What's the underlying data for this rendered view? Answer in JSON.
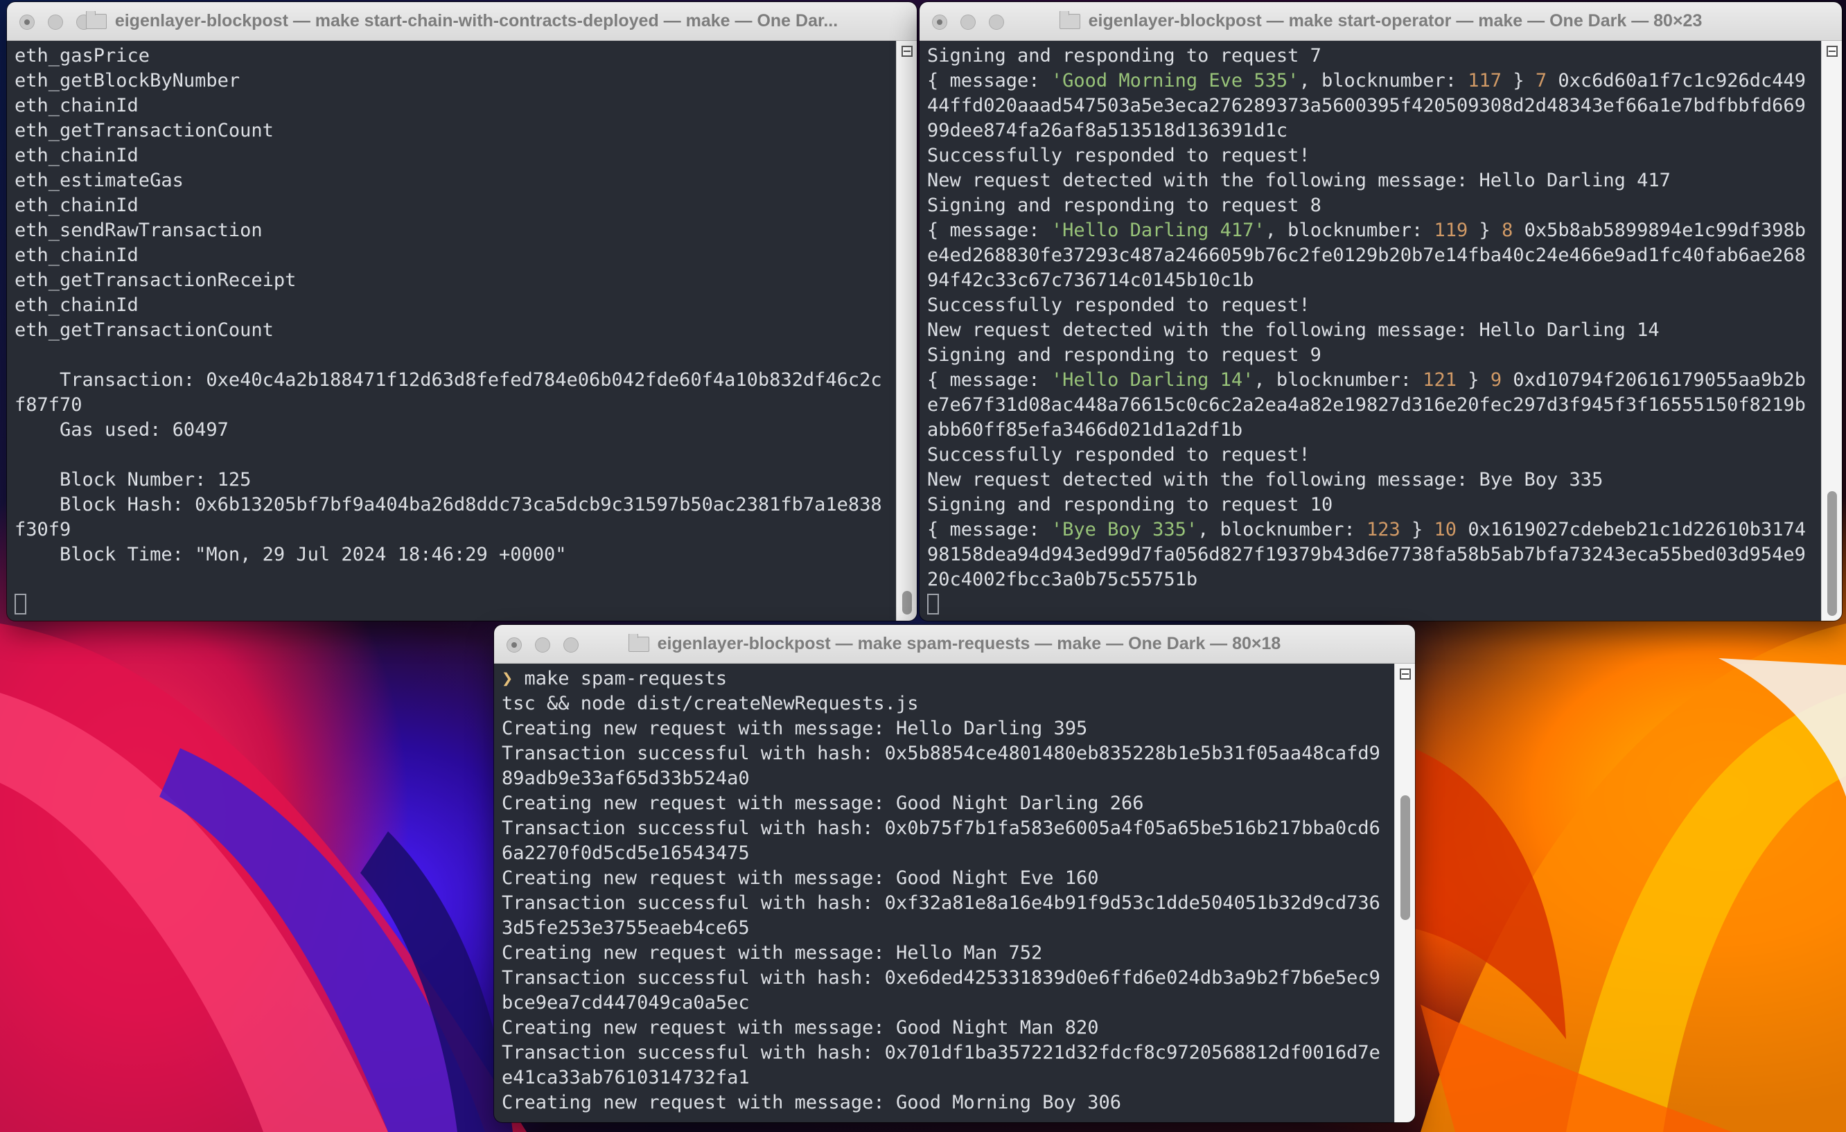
{
  "window_left": {
    "title": "eigenlayer-blockpost — make start-chain-with-contracts-deployed — make — One Dar...",
    "lines": [
      [
        {
          "t": "eth_gasPrice"
        }
      ],
      [
        {
          "t": "eth_getBlockByNumber"
        }
      ],
      [
        {
          "t": "eth_chainId"
        }
      ],
      [
        {
          "t": "eth_getTransactionCount"
        }
      ],
      [
        {
          "t": "eth_chainId"
        }
      ],
      [
        {
          "t": "eth_estimateGas"
        }
      ],
      [
        {
          "t": "eth_chainId"
        }
      ],
      [
        {
          "t": "eth_sendRawTransaction"
        }
      ],
      [
        {
          "t": "eth_chainId"
        }
      ],
      [
        {
          "t": "eth_getTransactionReceipt"
        }
      ],
      [
        {
          "t": "eth_chainId"
        }
      ],
      [
        {
          "t": "eth_getTransactionCount"
        }
      ],
      [
        {
          "t": ""
        }
      ],
      [
        {
          "t": "    Transaction: 0xe40c4a2b188471f12d63d8fefed784e06b042fde60f4a10b832df46c2cf87f70"
        }
      ],
      [
        {
          "t": "    Gas used: 60497"
        }
      ],
      [
        {
          "t": ""
        }
      ],
      [
        {
          "t": "    Block Number: 125"
        }
      ],
      [
        {
          "t": "    Block Hash: 0x6b13205bf7bf9a404ba26d8ddc73ca5dcb9c31597b50ac2381fb7a1e838f30f9"
        }
      ],
      [
        {
          "t": "    Block Time: \"Mon, 29 Jul 2024 18:46:29 +0000\""
        }
      ],
      [
        {
          "t": ""
        }
      ],
      [
        {
          "t": "",
          "cursor": true
        }
      ]
    ]
  },
  "window_right": {
    "title": "eigenlayer-blockpost — make start-operator — make — One Dark — 80×23",
    "lines": [
      [
        {
          "t": "Signing and responding to request 7"
        }
      ],
      [
        {
          "t": "{ message: "
        },
        {
          "t": "'Good Morning Eve 535'",
          "c": "g"
        },
        {
          "t": ", blocknumber: "
        },
        {
          "t": "117",
          "c": "o"
        },
        {
          "t": " } "
        },
        {
          "t": "7",
          "c": "o"
        },
        {
          "t": " 0xc6d60a1f7c1c926dc44944ffd020aaad547503a5e3eca276289373a5600395f420509308d2d48343ef66a1e7bdfbbfd66999dee874fa26af8a513518d136391d1c"
        }
      ],
      [
        {
          "t": "Successfully responded to request!"
        }
      ],
      [
        {
          "t": "New request detected with the following message: Hello Darling 417"
        }
      ],
      [
        {
          "t": "Signing and responding to request 8"
        }
      ],
      [
        {
          "t": "{ message: "
        },
        {
          "t": "'Hello Darling 417'",
          "c": "g"
        },
        {
          "t": ", blocknumber: "
        },
        {
          "t": "119",
          "c": "o"
        },
        {
          "t": " } "
        },
        {
          "t": "8",
          "c": "o"
        },
        {
          "t": " 0x5b8ab5899894e1c99df398be4ed268830fe37293c487a2466059b76c2fe0129b20b7e14fba40c24e466e9ad1fc40fab6ae26894f42c33c67c736714c0145b10c1b"
        }
      ],
      [
        {
          "t": "Successfully responded to request!"
        }
      ],
      [
        {
          "t": "New request detected with the following message: Hello Darling 14"
        }
      ],
      [
        {
          "t": "Signing and responding to request 9"
        }
      ],
      [
        {
          "t": "{ message: "
        },
        {
          "t": "'Hello Darling 14'",
          "c": "g"
        },
        {
          "t": ", blocknumber: "
        },
        {
          "t": "121",
          "c": "o"
        },
        {
          "t": " } "
        },
        {
          "t": "9",
          "c": "o"
        },
        {
          "t": " 0xd10794f20616179055aa9b2be7e67f31d08ac448a76615c0c6c2a2ea4a82e19827d316e20fec297d3f945f3f16555150f8219babb60ff85efa3466d021d1a2df1b"
        }
      ],
      [
        {
          "t": "Successfully responded to request!"
        }
      ],
      [
        {
          "t": "New request detected with the following message: Bye Boy 335"
        }
      ],
      [
        {
          "t": "Signing and responding to request 10"
        }
      ],
      [
        {
          "t": "{ message: "
        },
        {
          "t": "'Bye Boy 335'",
          "c": "g"
        },
        {
          "t": ", blocknumber: "
        },
        {
          "t": "123",
          "c": "o"
        },
        {
          "t": " } "
        },
        {
          "t": "10",
          "c": "o"
        },
        {
          "t": " 0x1619027cdebeb21c1d22610b317498158dea94d943ed99d7fa056d827f19379b43d6e7738fa58b5ab7bfa73243eca55bed03d954e920c4002fbcc3a0b75c55751b"
        }
      ],
      [
        {
          "t": "",
          "cursor": true
        }
      ]
    ]
  },
  "window_bottom": {
    "title": "eigenlayer-blockpost — make spam-requests — make — One Dark — 80×18",
    "lines": [
      [
        {
          "t": "❯",
          "c": "y"
        },
        {
          "t": " make spam-requests"
        }
      ],
      [
        {
          "t": "tsc && node dist/createNewRequests.js"
        }
      ],
      [
        {
          "t": "Creating new request with message: Hello Darling 395"
        }
      ],
      [
        {
          "t": "Transaction successful with hash: 0x5b8854ce4801480eb835228b1e5b31f05aa48cafd989adb9e33af65d33b524a0"
        }
      ],
      [
        {
          "t": "Creating new request with message: Good Night Darling 266"
        }
      ],
      [
        {
          "t": "Transaction successful with hash: 0x0b75f7b1fa583e6005a4f05a65be516b217bba0cd66a2270f0d5cd5e16543475"
        }
      ],
      [
        {
          "t": "Creating new request with message: Good Night Eve 160"
        }
      ],
      [
        {
          "t": "Transaction successful with hash: 0xf32a81e8a16e4b91f9d53c1dde504051b32d9cd7363d5fe253e3755eaeb4ce65"
        }
      ],
      [
        {
          "t": "Creating new request with message: Hello Man 752"
        }
      ],
      [
        {
          "t": "Transaction successful with hash: 0xe6ded425331839d0e6ffd6e024db3a9b2f7b6e5ec9bce9ea7cd447049ca0a5ec"
        }
      ],
      [
        {
          "t": "Creating new request with message: Good Night Man 820"
        }
      ],
      [
        {
          "t": "Transaction successful with hash: 0x701df1ba357221d32fdcf8c9720568812df0016d7ee41ca33ab7610314732fa1"
        }
      ],
      [
        {
          "t": "Creating new request with message: Good Morning Boy 306"
        }
      ]
    ]
  },
  "colors": {
    "terminal_bg": "#282c34",
    "terminal_fg": "#dcdfe4",
    "string_green": "#98c379",
    "number_orange": "#d19a66",
    "prompt_yellow": "#e5c07b"
  }
}
